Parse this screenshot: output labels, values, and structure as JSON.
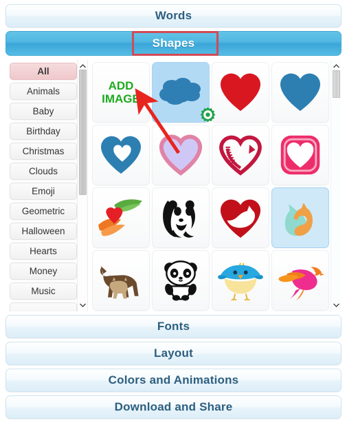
{
  "accordion": {
    "sections": [
      {
        "label": "Words",
        "state": "collapsed"
      },
      {
        "label": "Shapes",
        "state": "expanded"
      },
      {
        "label": "Fonts",
        "state": "collapsed"
      },
      {
        "label": "Layout",
        "state": "collapsed"
      },
      {
        "label": "Colors and Animations",
        "state": "collapsed"
      },
      {
        "label": "Download and Share",
        "state": "collapsed"
      }
    ]
  },
  "shapes_panel": {
    "categories": [
      {
        "label": "All",
        "selected": true
      },
      {
        "label": "Animals",
        "selected": false
      },
      {
        "label": "Baby",
        "selected": false
      },
      {
        "label": "Birthday",
        "selected": false
      },
      {
        "label": "Christmas",
        "selected": false
      },
      {
        "label": "Clouds",
        "selected": false
      },
      {
        "label": "Emoji",
        "selected": false
      },
      {
        "label": "Geometric",
        "selected": false
      },
      {
        "label": "Halloween",
        "selected": false
      },
      {
        "label": "Hearts",
        "selected": false
      },
      {
        "label": "Money",
        "selected": false
      },
      {
        "label": "Music",
        "selected": false
      }
    ],
    "add_image_label_line1": "ADD",
    "add_image_label_line2": "IMAGE",
    "thumbnails": [
      {
        "name": "add-image",
        "kind": "add",
        "selected": false
      },
      {
        "name": "cloud",
        "kind": "cloud",
        "selected": true
      },
      {
        "name": "red-heart",
        "kind": "heart-solid",
        "color": "#d81721",
        "selected": false
      },
      {
        "name": "blue-heart",
        "kind": "heart-solid",
        "color": "#2d7fb2",
        "selected": false
      },
      {
        "name": "blue-double-heart",
        "kind": "heart-cutout",
        "color": "#2d7fb2",
        "selected": false
      },
      {
        "name": "pink-outline-heart",
        "kind": "heart-outline",
        "color": "#e083a6",
        "fill": "#cfc8f7",
        "selected": false
      },
      {
        "name": "crimson-swirl-heart",
        "kind": "heart-swirl",
        "color": "#c2173f",
        "selected": false
      },
      {
        "name": "pink-square-heart",
        "kind": "heart-badge",
        "color": "#ed2d69",
        "selected": false
      },
      {
        "name": "hands-holding-heart",
        "kind": "hands-heart",
        "selected": false
      },
      {
        "name": "wwf-panda-logo",
        "kind": "panda-logo",
        "selected": false
      },
      {
        "name": "cat-in-heart",
        "kind": "cat-heart",
        "color": "#c2101b",
        "selected": false
      },
      {
        "name": "cat-and-dog-silhouette",
        "kind": "cat-dog",
        "selected": true
      },
      {
        "name": "dog-and-cat",
        "kind": "dog-cat",
        "selected": false
      },
      {
        "name": "cartoon-panda",
        "kind": "panda-cartoon",
        "selected": false
      },
      {
        "name": "blue-yellow-bird",
        "kind": "bird-chick",
        "selected": false
      },
      {
        "name": "pink-orange-bird",
        "kind": "bird-flying",
        "selected": false
      }
    ],
    "gear_badge": {
      "name": "settings-gear",
      "color": "#21a24a"
    },
    "left_scrollbar": {
      "up": "▲",
      "down": "▼"
    },
    "right_scrollbar": {
      "up": "▲",
      "down": "▼"
    }
  },
  "annotations": {
    "highlight_box_target": "Shapes",
    "arrow_target": "ADD IMAGE",
    "highlight_color": "#d24a55",
    "arrow_color": "#e8241f"
  },
  "colors": {
    "active_bar": "#4cb4df",
    "inactive_bar": "#e7f3fa",
    "bar_text": "#2d5f7f",
    "selected_category": "#efc8cb",
    "add_image_text": "#1faa1f"
  }
}
